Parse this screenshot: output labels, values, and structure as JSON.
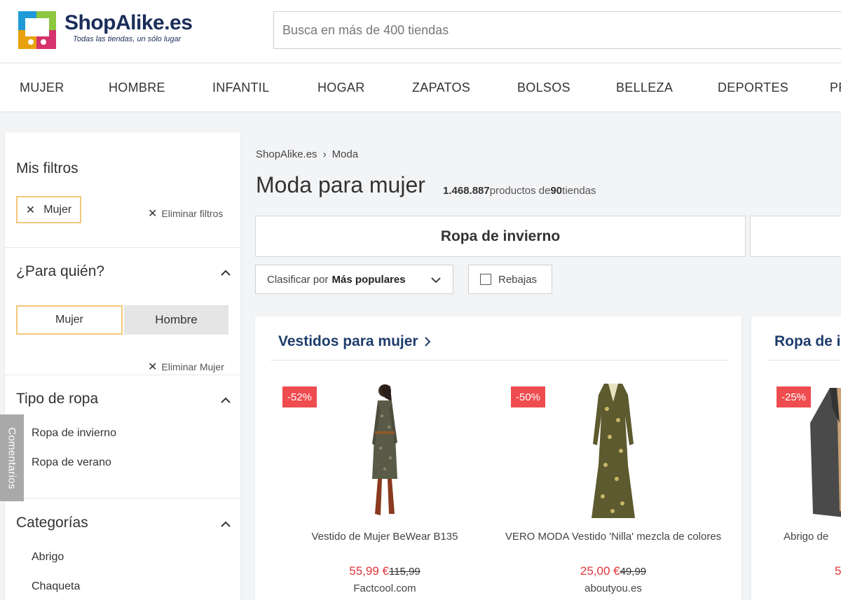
{
  "header": {
    "logo_name": "ShopAlike.es",
    "logo_tagline": "Todas las tiendas, un sólo lugar",
    "search_placeholder": "Busca en más de 400 tiendas"
  },
  "nav": [
    "MUJER",
    "HOMBRE",
    "INFANTIL",
    "HOGAR",
    "ZAPATOS",
    "BOLSOS",
    "BELLEZA",
    "DEPORTES",
    "PR"
  ],
  "sidebar": {
    "my_filters_title": "Mis filtros",
    "active_filter": "Mujer",
    "clear_filters": "Eliminar filtros",
    "for_whom_title": "¿Para quién?",
    "for_whom_options": [
      "Mujer",
      "Hombre"
    ],
    "clear_mujer": "Eliminar Mujer",
    "clothing_type_title": "Tipo de ropa",
    "clothing_type_items": [
      "Ropa de invierno",
      "Ropa de verano"
    ],
    "categories_title": "Categorías",
    "categories_items": [
      "Abrigo",
      "Chaqueta"
    ],
    "feedback_tab": "Comentarios"
  },
  "main": {
    "breadcrumb": [
      "ShopAlike.es",
      "Moda"
    ],
    "title": "Moda para mujer",
    "product_count": "1.468.887",
    "products_de": "productos de",
    "store_count": "90",
    "stores_label": "tiendas",
    "subcategory": "Ropa de invierno",
    "sort_prefix": "Clasificar por",
    "sort_value": "Más populares",
    "sale_filter": "Rebajas"
  },
  "cards": [
    {
      "title": "Vestidos para mujer",
      "products": [
        {
          "discount": "-52%",
          "name": "Vestido de Mujer BeWear B135",
          "price": "55,99 €",
          "old_price": "115,99",
          "shop": "Factcool.com"
        },
        {
          "discount": "-50%",
          "name": "VERO MODA Vestido 'Nilla' mezcla de colores",
          "price": "25,00 €",
          "old_price": "49,99",
          "shop": "aboutyou.es"
        }
      ]
    },
    {
      "title": "Ropa de i",
      "products": [
        {
          "discount": "-25%",
          "name": "Abrigo de",
          "price": "5",
          "shop": ""
        }
      ]
    }
  ],
  "colors": {
    "accent_border": "#f2c77a",
    "discount_badge": "#ef4c4f",
    "price_red": "#e0363b",
    "card_title": "#1e3d6b",
    "logo_text": "#1a2d5a"
  }
}
